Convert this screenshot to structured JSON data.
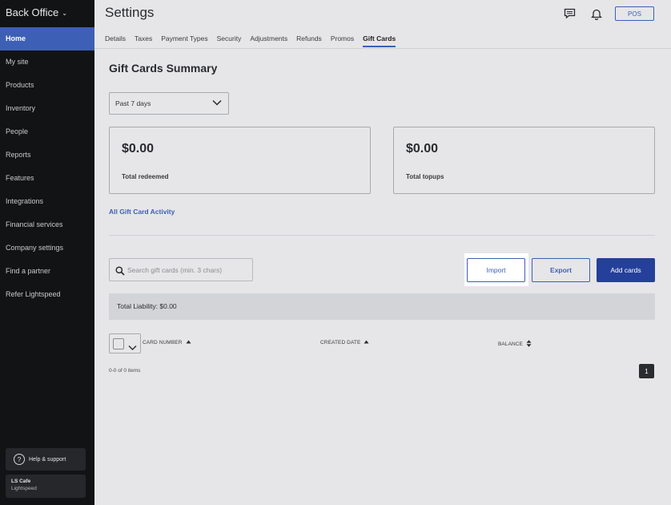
{
  "sidebar": {
    "brand": "Back Office",
    "items": [
      {
        "label": "Home"
      },
      {
        "label": "My site"
      },
      {
        "label": "Products"
      },
      {
        "label": "Inventory"
      },
      {
        "label": "People"
      },
      {
        "label": "Reports"
      },
      {
        "label": "Features"
      },
      {
        "label": "Integrations"
      },
      {
        "label": "Financial services"
      },
      {
        "label": "Company settings"
      },
      {
        "label": "Find a partner"
      },
      {
        "label": "Refer Lightspeed"
      }
    ],
    "help_label": "Help & support",
    "store_name": "LS Cafe",
    "store_sub": "Lightspeed"
  },
  "header": {
    "title": "Settings",
    "pos_label": "POS",
    "icons": [
      "chat-icon",
      "bell-icon"
    ]
  },
  "tabs": [
    {
      "label": "Details"
    },
    {
      "label": "Taxes"
    },
    {
      "label": "Payment Types"
    },
    {
      "label": "Security"
    },
    {
      "label": "Adjustments"
    },
    {
      "label": "Refunds"
    },
    {
      "label": "Promos"
    },
    {
      "label": "Gift Cards",
      "active": true
    }
  ],
  "summary": {
    "title": "Gift Cards Summary",
    "period": "Past 7 days",
    "cards": [
      {
        "amount": "$0.00",
        "label": "Total redeemed"
      },
      {
        "amount": "$0.00",
        "label": "Total topups"
      }
    ],
    "activity_link": "All Gift Card Activity"
  },
  "toolbar": {
    "search_placeholder": "Search gift cards (min. 3 chars)",
    "import_label": "Import",
    "export_label": "Export",
    "add_label": "Add cards"
  },
  "liability": "Total Liability: $0.00",
  "table": {
    "columns": [
      {
        "label": "CARD NUMBER",
        "sort": "asc"
      },
      {
        "label": "CREATED DATE",
        "sort": "asc"
      },
      {
        "label": "BALANCE",
        "sort": "both"
      }
    ],
    "count_text": "0-0 of 0 items",
    "page": "1"
  },
  "colors": {
    "accent": "#3d5fb5",
    "primary_button": "#24409a",
    "sidebar_bg": "#121315"
  }
}
